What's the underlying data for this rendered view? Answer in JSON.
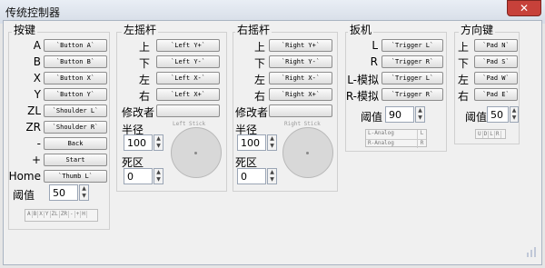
{
  "window": {
    "title": "传统控制器",
    "close_label": "✕"
  },
  "buttons_group": {
    "title": "按键",
    "rows": [
      {
        "label": "A",
        "value": "`Button A`"
      },
      {
        "label": "B",
        "value": "`Button B`"
      },
      {
        "label": "X",
        "value": "`Button X`"
      },
      {
        "label": "Y",
        "value": "`Button Y`"
      },
      {
        "label": "ZL",
        "value": "`Shoulder L`"
      },
      {
        "label": "ZR",
        "value": "`Shoulder R`"
      },
      {
        "label": "-",
        "value": "Back"
      },
      {
        "label": "+",
        "value": "Start"
      },
      {
        "label": "Home",
        "value": "`Thumb L`"
      }
    ],
    "threshold_label": "阈值",
    "threshold_value": "50",
    "mini_indicators": [
      "A",
      "B",
      "X",
      "Y",
      "ZL",
      "ZR",
      "-",
      "+",
      "H"
    ]
  },
  "left_stick": {
    "title": "左摇杆",
    "rows": [
      {
        "label": "上",
        "value": "`Left Y+`"
      },
      {
        "label": "下",
        "value": "`Left Y-`"
      },
      {
        "label": "左",
        "value": "`Left X-`"
      },
      {
        "label": "右",
        "value": "`Left X+`"
      }
    ],
    "modifier_label": "修改者",
    "modifier_value": "",
    "radius_label": "半径",
    "radius_value": "100",
    "deadzone_label": "死区",
    "deadzone_value": "0",
    "circle_caption": "Left Stick"
  },
  "right_stick": {
    "title": "右摇杆",
    "rows": [
      {
        "label": "上",
        "value": "`Right Y+`"
      },
      {
        "label": "下",
        "value": "`Right Y-`"
      },
      {
        "label": "左",
        "value": "`Right X-`"
      },
      {
        "label": "右",
        "value": "`Right X+`"
      }
    ],
    "modifier_label": "修改者",
    "modifier_value": "",
    "radius_label": "半径",
    "radius_value": "100",
    "deadzone_label": "死区",
    "deadzone_value": "0",
    "circle_caption": "Right Stick"
  },
  "triggers": {
    "title": "扳机",
    "rows": [
      {
        "label": "L",
        "value": "`Trigger L`"
      },
      {
        "label": "R",
        "value": "`Trigger R`"
      },
      {
        "label": "L-模拟",
        "value": "`Trigger L`"
      },
      {
        "label": "R-模拟",
        "value": "`Trigger R`"
      }
    ],
    "threshold_label": "阈值",
    "threshold_value": "90",
    "analog_rows": [
      {
        "name": "L-Analog",
        "key": "L"
      },
      {
        "name": "R-Analog",
        "key": "R"
      }
    ]
  },
  "dpad": {
    "title": "方向键",
    "rows": [
      {
        "label": "上",
        "value": "`Pad N`"
      },
      {
        "label": "下",
        "value": "`Pad S`"
      },
      {
        "label": "左",
        "value": "`Pad W`"
      },
      {
        "label": "右",
        "value": "`Pad E`"
      }
    ],
    "threshold_label": "阈值",
    "threshold_value": "50",
    "mini_indicators": [
      "U",
      "D",
      "L",
      "R"
    ]
  }
}
